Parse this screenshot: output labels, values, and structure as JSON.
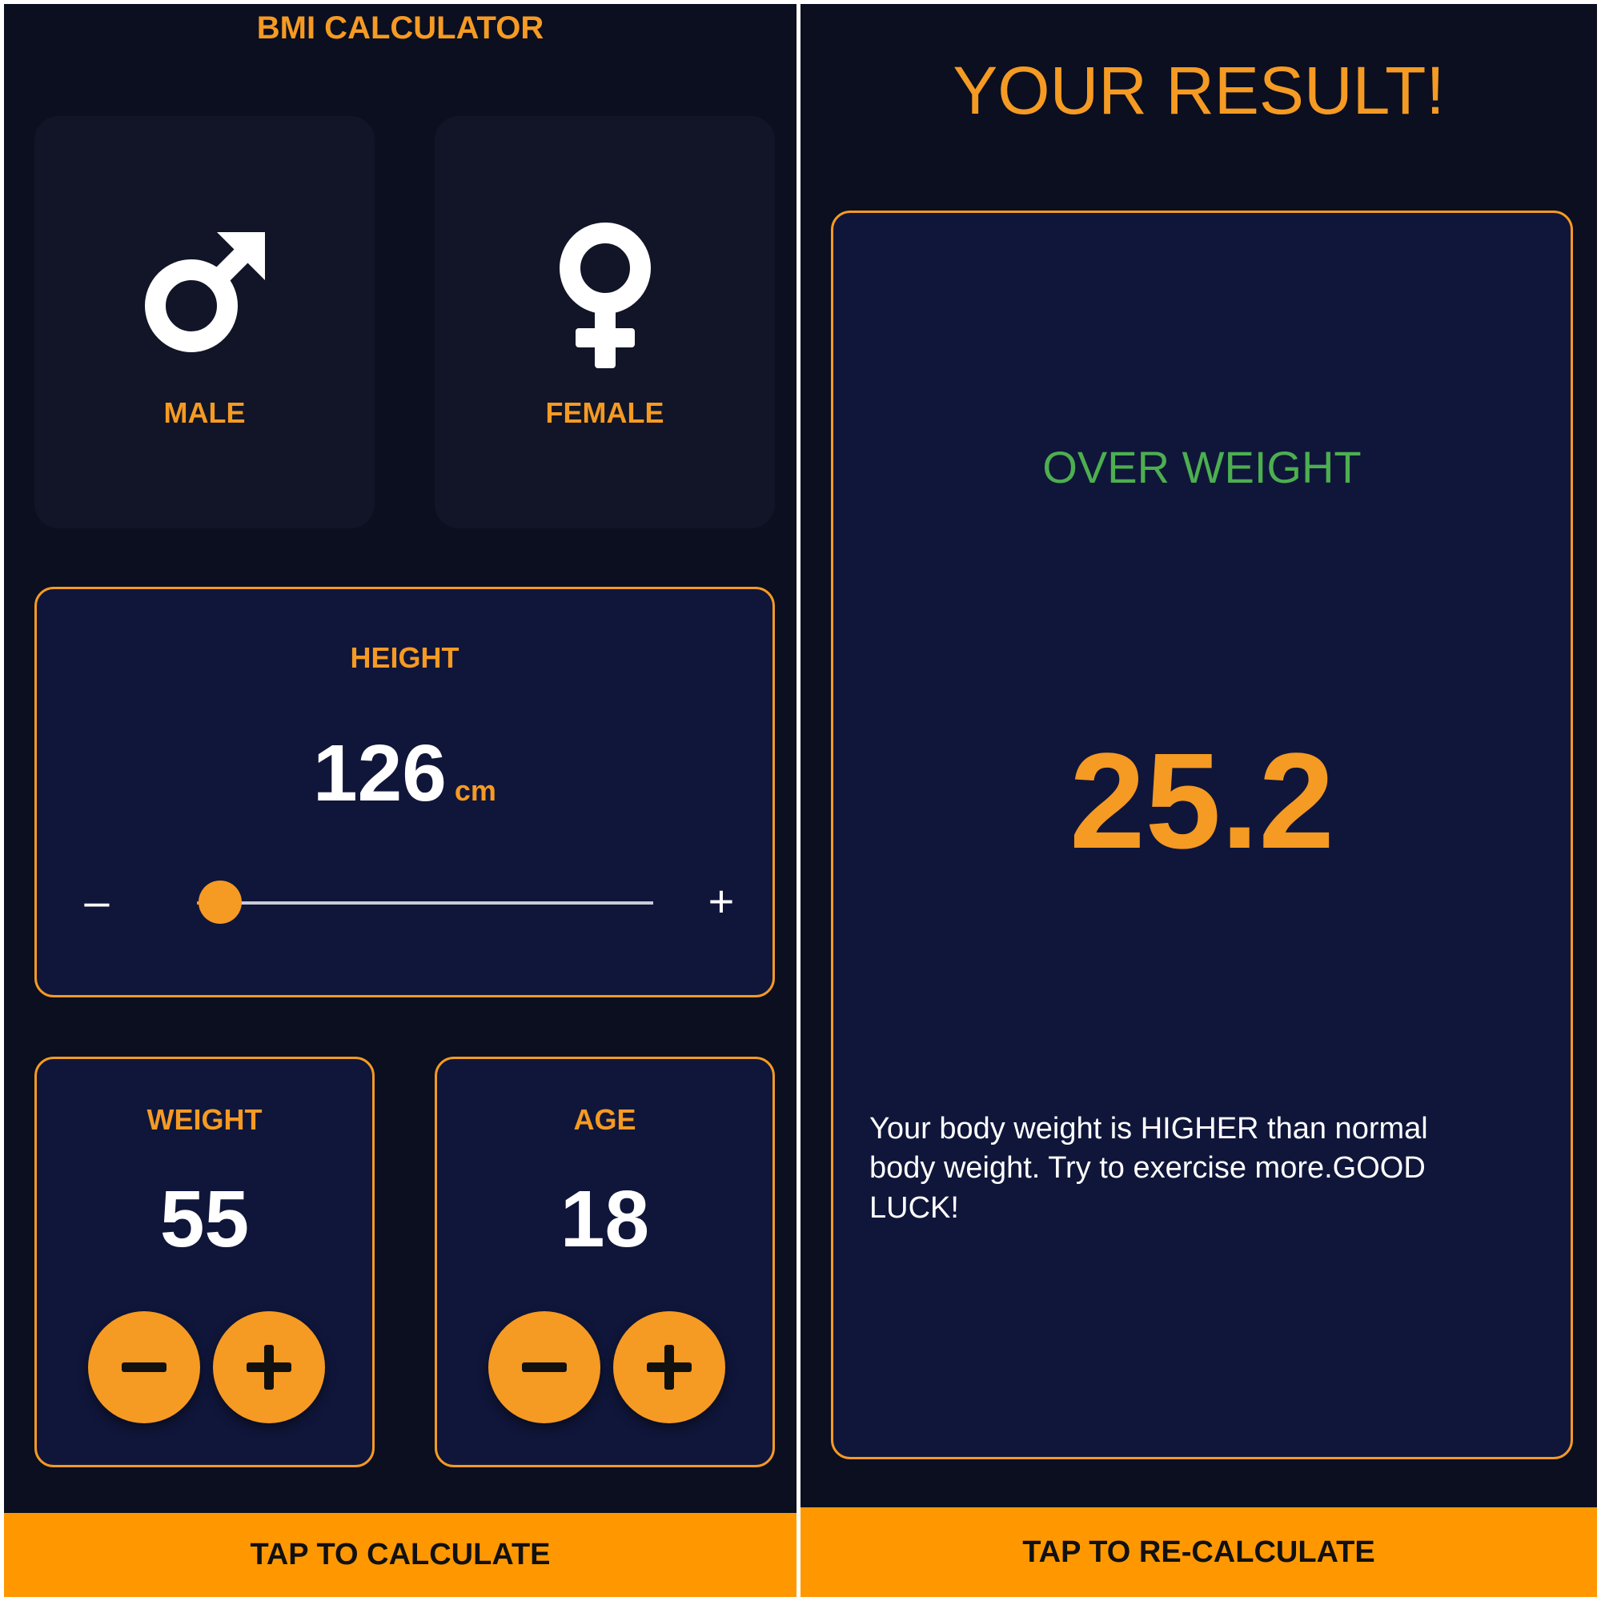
{
  "input_screen": {
    "title": "BMI CALCULATOR",
    "gender": {
      "male": {
        "label": "MALE",
        "icon": "male-icon"
      },
      "female": {
        "label": "FEMALE",
        "icon": "female-icon"
      }
    },
    "height": {
      "label": "HEIGHT",
      "value": "126",
      "unit": "cm",
      "slider_fraction": 0.05
    },
    "weight": {
      "label": "WEIGHT",
      "value": "55"
    },
    "age": {
      "label": "AGE",
      "value": "18"
    },
    "calculate_button": "TAP TO CALCULATE"
  },
  "result_screen": {
    "heading": "YOUR RESULT!",
    "status": "OVER WEIGHT",
    "bmi_value": "25.2",
    "message": "Your body weight is HIGHER than normal body weight. Try to exercise more.GOOD LUCK!",
    "recalculate_button": "TAP TO RE-CALCULATE"
  },
  "colors": {
    "background": "#0b0f1f",
    "card": "#111527",
    "active_card": "#10163a",
    "accent": "#f59a23",
    "button_bar": "#ff9800",
    "status_green": "#4caf50",
    "text": "#ffffff"
  }
}
